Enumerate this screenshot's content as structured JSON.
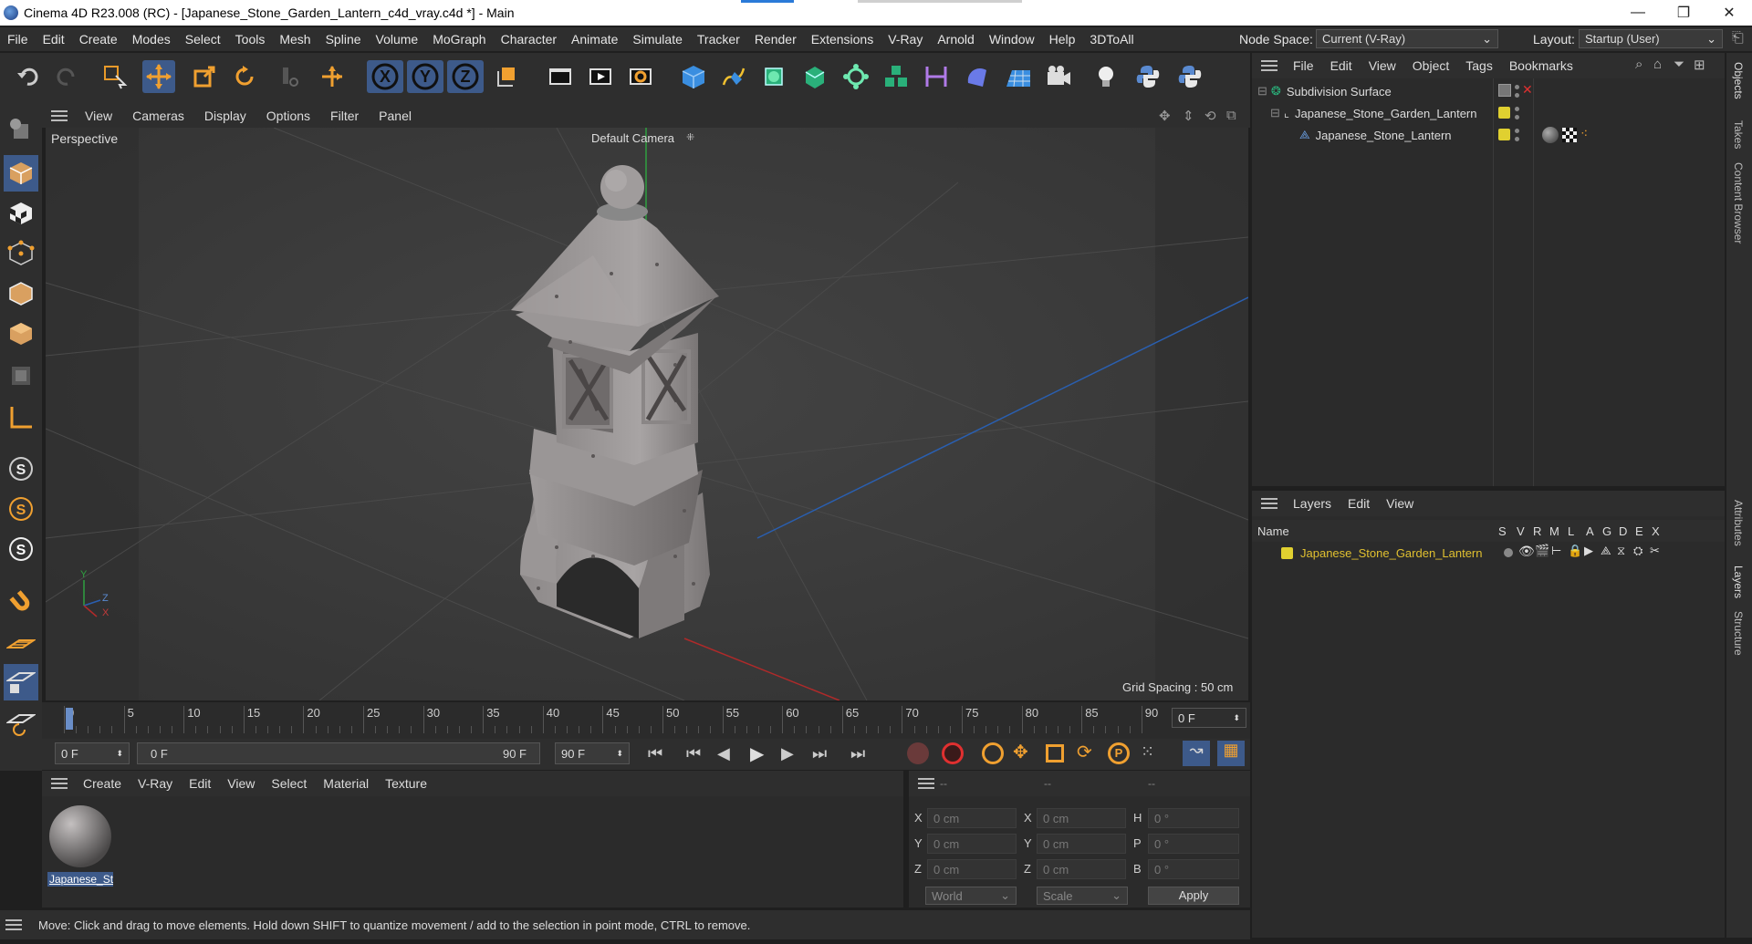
{
  "window": {
    "title": "Cinema 4D R23.008 (RC) - [Japanese_Stone_Garden_Lantern_c4d_vray.c4d *] - Main",
    "minimize": "—",
    "restore": "❐",
    "close": "✕"
  },
  "menubar": {
    "items": [
      "File",
      "Edit",
      "Create",
      "Modes",
      "Select",
      "Tools",
      "Mesh",
      "Spline",
      "Volume",
      "MoGraph",
      "Character",
      "Animate",
      "Simulate",
      "Tracker",
      "Render",
      "Extensions",
      "V-Ray",
      "Arnold",
      "Window",
      "Help",
      "3DToAll"
    ],
    "node_space_label": "Node Space:",
    "node_space_value": "Current (V-Ray)",
    "layout_label": "Layout:",
    "layout_value": "Startup (User)"
  },
  "viewport": {
    "menu": [
      "View",
      "Cameras",
      "Display",
      "Options",
      "Filter",
      "Panel"
    ],
    "projection": "Perspective",
    "camera": "Default Camera",
    "grid_spacing": "Grid Spacing : 50 cm",
    "axis_y": "Y",
    "axis_z": "Z",
    "axis_x": "X"
  },
  "timeline": {
    "ticks": [
      "0",
      "5",
      "10",
      "15",
      "20",
      "25",
      "30",
      "35",
      "40",
      "45",
      "50",
      "55",
      "60",
      "65",
      "70",
      "75",
      "80",
      "85",
      "90"
    ],
    "current_frame": "0 F",
    "start_frame": "0 F",
    "range_start": "0 F",
    "range_end": "90 F",
    "end_frame": "90 F"
  },
  "material_panel": {
    "menu": [
      "Create",
      "V-Ray",
      "Edit",
      "View",
      "Select",
      "Material",
      "Texture"
    ],
    "material_name": "Japanese_St"
  },
  "coordinates": {
    "headers": [
      "--",
      "--",
      "--"
    ],
    "rows": [
      {
        "a": "X",
        "av": "0 cm",
        "b": "X",
        "bv": "0 cm",
        "c": "H",
        "cv": "0 °"
      },
      {
        "a": "Y",
        "av": "0 cm",
        "b": "Y",
        "bv": "0 cm",
        "c": "P",
        "cv": "0 °"
      },
      {
        "a": "Z",
        "av": "0 cm",
        "b": "Z",
        "bv": "0 cm",
        "c": "B",
        "cv": "0 °"
      }
    ],
    "mode": "World",
    "scale": "Scale",
    "apply": "Apply"
  },
  "status": "Move: Click and drag to move elements. Hold down SHIFT to quantize movement / add to the selection in point mode, CTRL to remove.",
  "objects_panel": {
    "menu": [
      "File",
      "Edit",
      "View",
      "Object",
      "Tags",
      "Bookmarks"
    ],
    "items": [
      "Subdivision Surface",
      "Japanese_Stone_Garden_Lantern",
      "Japanese_Stone_Lantern"
    ]
  },
  "layers_panel": {
    "menu": [
      "Layers",
      "Edit",
      "View"
    ],
    "col_name": "Name",
    "cols": [
      "S",
      "V",
      "R",
      "M",
      "L",
      "A",
      "G",
      "D",
      "E",
      "X"
    ],
    "layer_name": "Japanese_Stone_Garden_Lantern"
  },
  "right_tabs": [
    "Objects",
    "Takes",
    "Content Browser",
    "Attributes",
    "Layers",
    "Structure"
  ],
  "colors": {
    "accent": "#3d5a8a",
    "layer_text": "#e0c030",
    "layer_color": "#e0d030"
  }
}
